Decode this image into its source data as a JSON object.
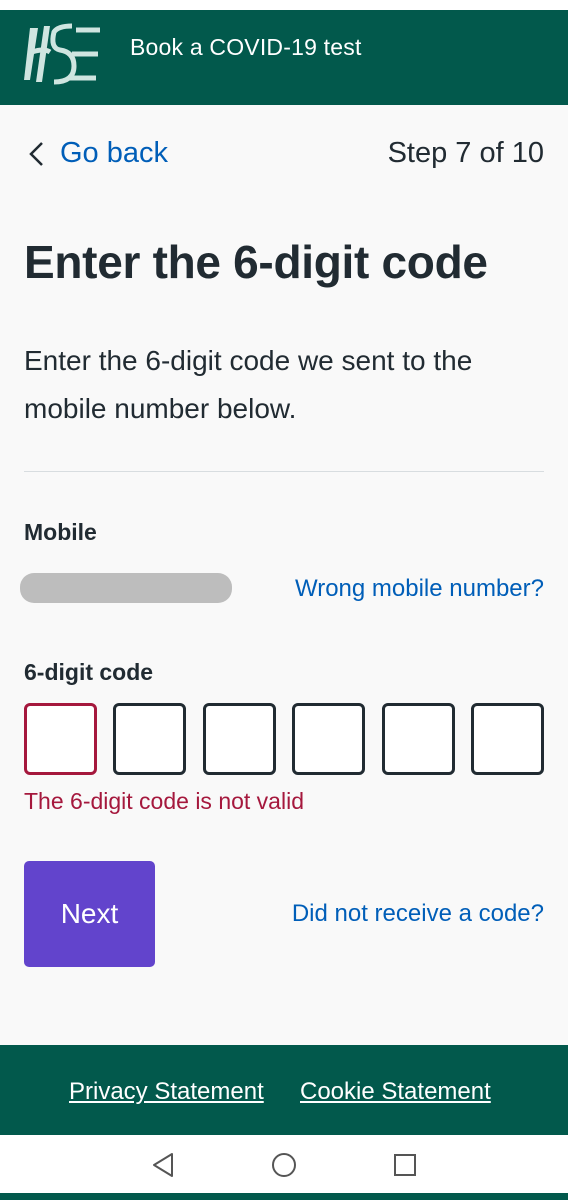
{
  "header": {
    "title": "Book a COVID-19 test",
    "logo_text": "HSE"
  },
  "navigation": {
    "back_label": "Go back",
    "step": "Step 7 of 10"
  },
  "page": {
    "title": "Enter the 6-digit code",
    "intro": "Enter the 6-digit code we sent to the mobile number below."
  },
  "mobile": {
    "label": "Mobile",
    "value_redacted": true,
    "wrong_link": "Wrong mobile number?"
  },
  "code": {
    "label": "6-digit code",
    "digits": [
      "",
      "",
      "",
      "",
      "",
      ""
    ],
    "error": "The 6-digit code is not valid"
  },
  "actions": {
    "next_label": "Next",
    "no_code_link": "Did not receive a code?"
  },
  "footer": {
    "privacy": "Privacy Statement",
    "cookie": "Cookie Statement"
  },
  "android_nav": [
    "back-icon",
    "home-icon",
    "recents-icon"
  ],
  "colors": {
    "brand_green": "#02594c",
    "link_blue": "#005eb8",
    "button_purple": "#6244cc",
    "error_red": "#a5183d"
  }
}
